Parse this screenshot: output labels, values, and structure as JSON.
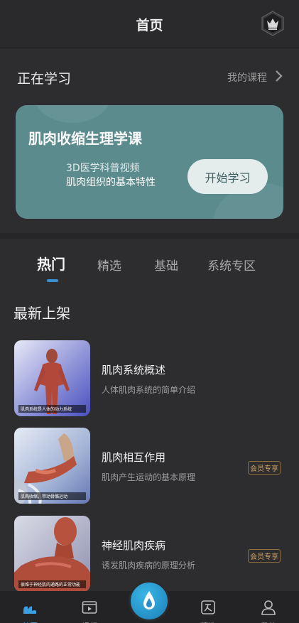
{
  "header": {
    "title": "首页",
    "vip_icon": "crown-icon"
  },
  "learning": {
    "section_title": "正在学习",
    "my_courses_label": "我的课程",
    "card": {
      "title": "肌肉收缩生理学课",
      "subtitle_line1": "3D医学科普视频",
      "subtitle_line2": "肌肉组织的基本特性",
      "start_button": "开始学习"
    }
  },
  "tabs": [
    {
      "label": "热门",
      "active": true
    },
    {
      "label": "精选",
      "active": false
    },
    {
      "label": "基础",
      "active": false
    },
    {
      "label": "系统专区",
      "active": false
    }
  ],
  "new_section": {
    "title": "最新上架",
    "items": [
      {
        "name": "肌肉系统概述",
        "desc": "人体肌肉系统的简单介绍",
        "badge": "",
        "caption": "肌肉系统是人体的动力系统"
      },
      {
        "name": "肌肉相互作用",
        "desc": "肌肉产生运动的基本原理",
        "badge": "会员专享",
        "caption": "肌肉收缩，带动骨骼运动"
      },
      {
        "name": "神经肌肉疾病",
        "desc": "诱发肌肉疾病的原理分析",
        "badge": "会员专享",
        "caption": "很难于神经肌肉通路的正常功能"
      }
    ]
  },
  "bottom_nav": [
    {
      "label": "首页",
      "icon": "home-icon",
      "active": true
    },
    {
      "label": "视频",
      "icon": "video-icon",
      "active": false
    },
    {
      "label": "",
      "icon": "drop-icon",
      "active": false
    },
    {
      "label": "精选",
      "icon": "article-icon",
      "active": false
    },
    {
      "label": "我的",
      "icon": "profile-icon",
      "active": false
    }
  ],
  "colors": {
    "accent": "#3a90d0",
    "card": "#5b8b8d",
    "vip": "#c8a060"
  }
}
